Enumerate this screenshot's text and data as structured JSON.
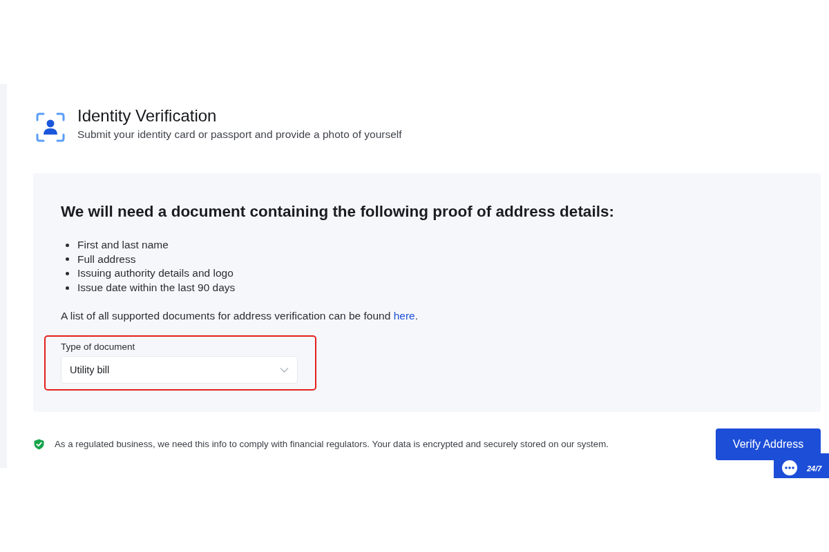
{
  "header": {
    "title": "Identity Verification",
    "subtitle": "Submit your identity card or passport and provide a photo of yourself"
  },
  "requirements": {
    "heading": "We will need a document containing the following proof of address details:",
    "items": [
      "First and last name",
      "Full address",
      "Issuing authority details and logo",
      "Issue date within the last 90 days"
    ],
    "note": {
      "before": "A list of all supported documents for address verification can be found",
      "link": "here",
      "after": "."
    }
  },
  "document_type": {
    "label": "Type of document",
    "value": "Utility bill",
    "highlighted": true
  },
  "footer": {
    "notice": "As a regulated business, we need this info to comply with financial regulators. Your data is encrypted and securely stored on our system.",
    "button": "Verify Address"
  },
  "chat_widget": {
    "label": "24/7"
  }
}
